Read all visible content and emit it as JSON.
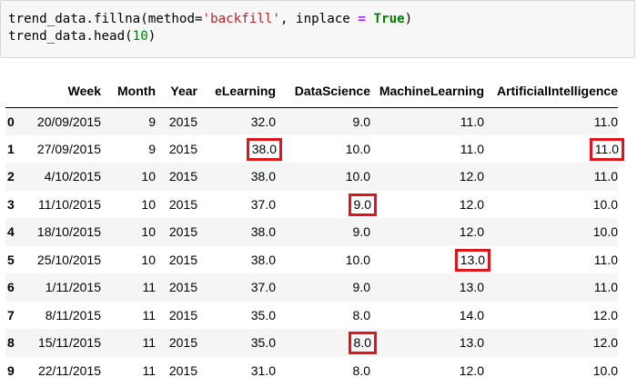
{
  "notebook": {
    "code_lines": [
      {
        "tokens": [
          {
            "t": "trend_data.fillna(method=",
            "c": "plain"
          },
          {
            "t": "'backfill'",
            "c": "str"
          },
          {
            "t": ", inplace ",
            "c": "plain"
          },
          {
            "t": "=",
            "c": "op"
          },
          {
            "t": " ",
            "c": "plain"
          },
          {
            "t": "True",
            "c": "kw"
          },
          {
            "t": ")",
            "c": "plain"
          }
        ]
      },
      {
        "tokens": [
          {
            "t": "trend_data.head(",
            "c": "plain"
          },
          {
            "t": "10",
            "c": "num"
          },
          {
            "t": ")",
            "c": "plain"
          }
        ]
      }
    ]
  },
  "dataframe": {
    "columns": [
      "",
      "Week",
      "Month",
      "Year",
      "eLearning",
      "DataScience",
      "MachineLearning",
      "ArtificialIntelligence"
    ],
    "rows": [
      {
        "index": "0",
        "cells": [
          "20/09/2015",
          "9",
          "2015",
          "32.0",
          "9.0",
          "11.0",
          "11.0"
        ],
        "highlighted": []
      },
      {
        "index": "1",
        "cells": [
          "27/09/2015",
          "9",
          "2015",
          "38.0",
          "10.0",
          "11.0",
          "11.0"
        ],
        "highlighted": [
          3,
          6
        ]
      },
      {
        "index": "2",
        "cells": [
          "4/10/2015",
          "10",
          "2015",
          "38.0",
          "10.0",
          "12.0",
          "11.0"
        ],
        "highlighted": []
      },
      {
        "index": "3",
        "cells": [
          "11/10/2015",
          "10",
          "2015",
          "37.0",
          "9.0",
          "12.0",
          "10.0"
        ],
        "highlighted": [
          4
        ]
      },
      {
        "index": "4",
        "cells": [
          "18/10/2015",
          "10",
          "2015",
          "38.0",
          "9.0",
          "12.0",
          "10.0"
        ],
        "highlighted": []
      },
      {
        "index": "5",
        "cells": [
          "25/10/2015",
          "10",
          "2015",
          "38.0",
          "10.0",
          "13.0",
          "11.0"
        ],
        "highlighted": [
          5
        ]
      },
      {
        "index": "6",
        "cells": [
          "1/11/2015",
          "11",
          "2015",
          "37.0",
          "9.0",
          "13.0",
          "11.0"
        ],
        "highlighted": []
      },
      {
        "index": "7",
        "cells": [
          "8/11/2015",
          "11",
          "2015",
          "35.0",
          "8.0",
          "14.0",
          "12.0"
        ],
        "highlighted": []
      },
      {
        "index": "8",
        "cells": [
          "15/11/2015",
          "11",
          "2015",
          "35.0",
          "8.0",
          "13.0",
          "12.0"
        ],
        "highlighted": [
          4
        ]
      },
      {
        "index": "9",
        "cells": [
          "22/11/2015",
          "11",
          "2015",
          "31.0",
          "8.0",
          "12.0",
          "10.0"
        ],
        "highlighted": []
      }
    ]
  },
  "colors": {
    "highlight_box": "#e0141b",
    "code_background": "#f7f7f7",
    "row_stripe": "#f5f5f5"
  }
}
